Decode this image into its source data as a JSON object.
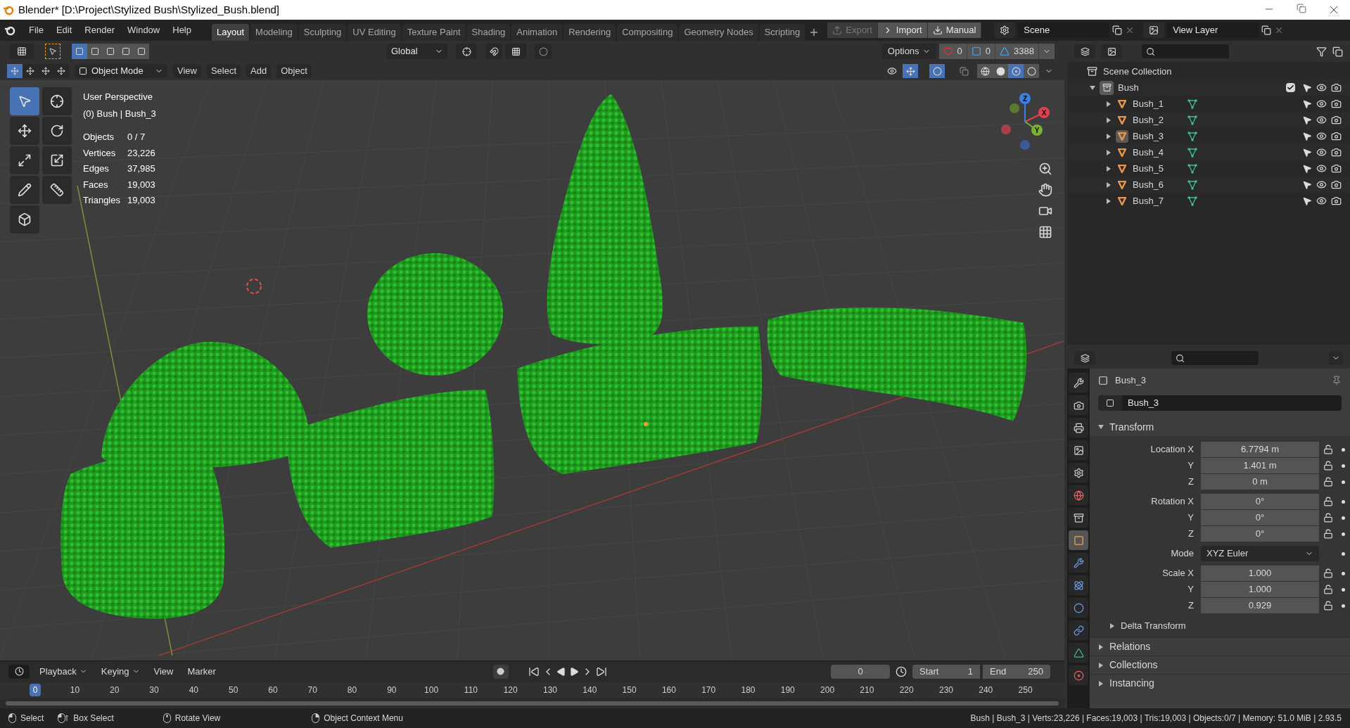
{
  "window": {
    "title": "Blender* [D:\\Project\\Stylized Bush\\Stylized_Bush.blend]"
  },
  "menu": [
    "File",
    "Edit",
    "Render",
    "Window",
    "Help"
  ],
  "workspaces": [
    {
      "label": "Layout",
      "selected": true
    },
    {
      "label": "Modeling",
      "selected": false
    },
    {
      "label": "Sculpting",
      "selected": false
    },
    {
      "label": "UV Editing",
      "selected": false
    },
    {
      "label": "Texture Paint",
      "selected": false
    },
    {
      "label": "Shading",
      "selected": false
    },
    {
      "label": "Animation",
      "selected": false
    },
    {
      "label": "Rendering",
      "selected": false
    },
    {
      "label": "Compositing",
      "selected": false
    },
    {
      "label": "Geometry Nodes",
      "selected": false
    },
    {
      "label": "Scripting",
      "selected": false
    }
  ],
  "addon_buttons": [
    {
      "label": "Export",
      "kind": "export",
      "disabled": true
    },
    {
      "label": "Import",
      "kind": "import",
      "disabled": false
    },
    {
      "label": "Manual",
      "kind": "manual",
      "disabled": false
    }
  ],
  "scene": "Scene",
  "view_layer": "View Layer",
  "tool_header": {
    "select_modes": [
      {
        "selected": true
      },
      {
        "selected": false
      },
      {
        "selected": false
      },
      {
        "selected": false
      },
      {
        "selected": false
      }
    ],
    "orientation": "Global",
    "snap_on": false,
    "options": "Options",
    "counters": [
      {
        "kind": "heart",
        "value": "0"
      },
      {
        "kind": "box",
        "value": "0"
      },
      {
        "kind": "mesh",
        "value": "3388"
      }
    ]
  },
  "view_header": {
    "mode": "Object Mode",
    "menus": [
      "View",
      "Select",
      "Add",
      "Object"
    ],
    "shading": [
      {
        "kind": "wireframe",
        "selected": false
      },
      {
        "kind": "solid",
        "selected": false
      },
      {
        "kind": "material",
        "selected": true
      },
      {
        "kind": "rendered",
        "selected": false
      }
    ]
  },
  "tools": [
    {
      "kind": "select",
      "selected": true
    },
    {
      "kind": "cursor",
      "selected": false
    },
    {
      "kind": "move",
      "selected": false
    },
    {
      "kind": "rotate",
      "selected": false
    },
    {
      "kind": "scale",
      "selected": false
    },
    {
      "kind": "transform",
      "selected": false
    },
    {
      "kind": "annotate",
      "selected": false
    },
    {
      "kind": "measure",
      "selected": false
    },
    {
      "kind": "add_cube",
      "selected": false
    }
  ],
  "overlay": {
    "view_name": "User Perspective",
    "context": "(0) Bush | Bush_3",
    "stats": [
      {
        "label": "Objects",
        "value": "0 / 7"
      },
      {
        "label": "Vertices",
        "value": "23,226"
      },
      {
        "label": "Edges",
        "value": "37,985"
      },
      {
        "label": "Faces",
        "value": "19,003"
      },
      {
        "label": "Triangles",
        "value": "19,003"
      }
    ]
  },
  "gizmo": {
    "axes": [
      "X",
      "Y",
      "Z"
    ]
  },
  "outliner": {
    "root": "Scene Collection",
    "collection": {
      "name": "Bush",
      "expanded": true,
      "checked": true,
      "children": [
        {
          "name": "Bush_1",
          "active": false
        },
        {
          "name": "Bush_2",
          "active": false
        },
        {
          "name": "Bush_3",
          "active": true
        },
        {
          "name": "Bush_4",
          "active": false
        },
        {
          "name": "Bush_5",
          "active": false
        },
        {
          "name": "Bush_6",
          "active": false
        },
        {
          "name": "Bush_7",
          "active": false
        }
      ]
    }
  },
  "properties": {
    "tabs": [
      {
        "kind": "tool",
        "selected": false
      },
      {
        "kind": "render",
        "selected": false
      },
      {
        "kind": "output",
        "selected": false
      },
      {
        "kind": "view_layer",
        "selected": false
      },
      {
        "kind": "scene",
        "selected": false
      },
      {
        "kind": "world",
        "selected": false
      },
      {
        "kind": "collection",
        "selected": false
      },
      {
        "kind": "object",
        "selected": true
      },
      {
        "kind": "modifiers",
        "selected": false
      },
      {
        "kind": "particles",
        "selected": false
      },
      {
        "kind": "physics",
        "selected": false
      },
      {
        "kind": "constraints",
        "selected": false
      },
      {
        "kind": "data",
        "selected": false
      },
      {
        "kind": "material",
        "selected": false
      }
    ],
    "object_name": "Bush_3",
    "name_field": "Bush_3",
    "transform": {
      "title": "Transform",
      "expanded": true,
      "groups": [
        [
          {
            "label": "Location X",
            "value": "6.7794 m",
            "kind": "number"
          },
          {
            "label": "Y",
            "value": "1.401 m",
            "kind": "number"
          },
          {
            "label": "Z",
            "value": "0 m",
            "kind": "number"
          }
        ],
        [
          {
            "label": "Rotation X",
            "value": "0°",
            "kind": "number"
          },
          {
            "label": "Y",
            "value": "0°",
            "kind": "number"
          },
          {
            "label": "Z",
            "value": "0°",
            "kind": "number"
          }
        ],
        [
          {
            "label": "Mode",
            "value": "XYZ Euler",
            "kind": "dropdown"
          }
        ],
        [
          {
            "label": "Scale X",
            "value": "1.000",
            "kind": "number"
          },
          {
            "label": "Y",
            "value": "1.000",
            "kind": "number"
          },
          {
            "label": "Z",
            "value": "0.929",
            "kind": "number"
          }
        ]
      ],
      "subpanel": {
        "title": "Delta Transform",
        "expanded": false
      }
    },
    "panels": [
      {
        "title": "Relations",
        "expanded": false
      },
      {
        "title": "Collections",
        "expanded": false
      },
      {
        "title": "Instancing",
        "expanded": false
      }
    ]
  },
  "timeline": {
    "menus": [
      "Playback",
      "Keying",
      "View",
      "Marker"
    ],
    "current_frame": "0",
    "start_label": "Start",
    "start": "1",
    "end_label": "End",
    "end": "250",
    "ticks": [
      {
        "label": "0",
        "selected": true
      },
      {
        "label": "10",
        "selected": false
      },
      {
        "label": "20",
        "selected": false
      },
      {
        "label": "30",
        "selected": false
      },
      {
        "label": "40",
        "selected": false
      },
      {
        "label": "50",
        "selected": false
      },
      {
        "label": "60",
        "selected": false
      },
      {
        "label": "70",
        "selected": false
      },
      {
        "label": "80",
        "selected": false
      },
      {
        "label": "90",
        "selected": false
      },
      {
        "label": "100",
        "selected": false
      },
      {
        "label": "110",
        "selected": false
      },
      {
        "label": "120",
        "selected": false
      },
      {
        "label": "130",
        "selected": false
      },
      {
        "label": "140",
        "selected": false
      },
      {
        "label": "150",
        "selected": false
      },
      {
        "label": "160",
        "selected": false
      },
      {
        "label": "170",
        "selected": false
      },
      {
        "label": "180",
        "selected": false
      },
      {
        "label": "190",
        "selected": false
      },
      {
        "label": "200",
        "selected": false
      },
      {
        "label": "210",
        "selected": false
      },
      {
        "label": "220",
        "selected": false
      },
      {
        "label": "230",
        "selected": false
      },
      {
        "label": "240",
        "selected": false
      },
      {
        "label": "250",
        "selected": false
      }
    ]
  },
  "status_bar": {
    "hints": [
      {
        "label": "Select",
        "kind": "left"
      },
      {
        "label": "Box Select",
        "kind": "drag"
      },
      {
        "label": "Rotate View",
        "kind": "middle"
      },
      {
        "label": "Object Context Menu",
        "kind": "right"
      }
    ],
    "info": "Bush | Bush_3 | Verts:23,226 | Faces:19,003 | Tris:19,003 | Objects:0/7 | Memory: 51.0 MiB | 2.93.5"
  }
}
